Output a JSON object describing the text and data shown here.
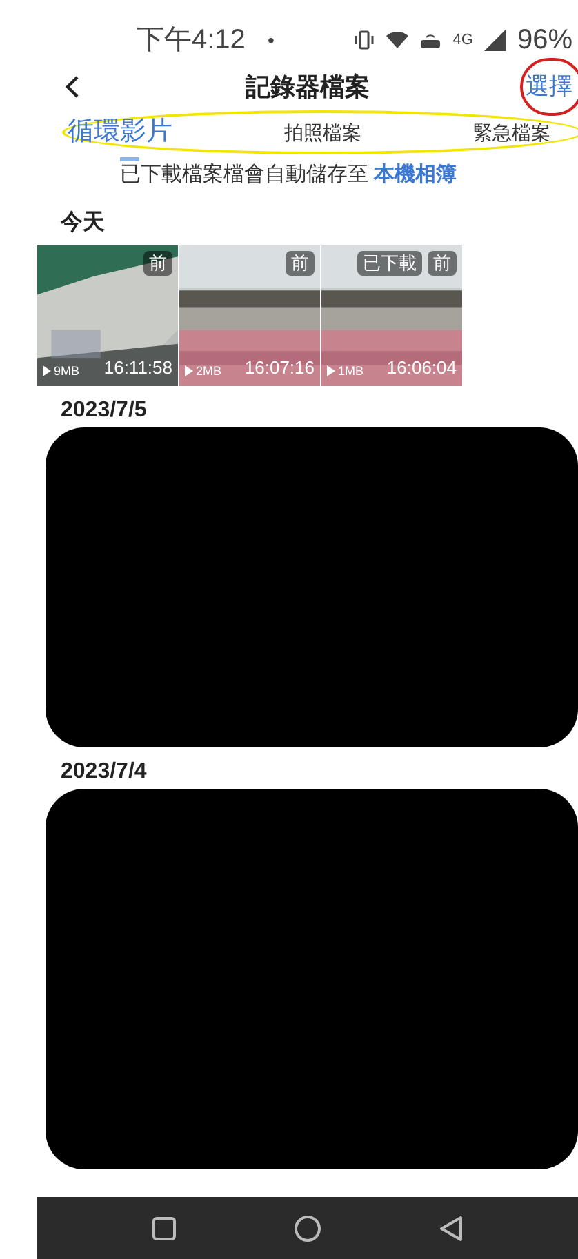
{
  "status_bar": {
    "time": "下午4:12",
    "dot": "•",
    "network": "4G",
    "battery": "96%"
  },
  "header": {
    "title": "記錄器檔案",
    "action": "選擇"
  },
  "tabs": [
    {
      "label": "循環影片",
      "selected": true
    },
    {
      "label": "拍照檔案",
      "selected": false
    },
    {
      "label": "緊急檔案",
      "selected": false
    }
  ],
  "notice": {
    "text": "已下載檔案檔會自動儲存至",
    "link": "本機相簿"
  },
  "sections": [
    {
      "date": "今天",
      "videos": [
        {
          "camera": "前",
          "size": "9MB",
          "time": "16:11:58"
        },
        {
          "camera": "前",
          "size": "2MB",
          "time": "16:07:16"
        },
        {
          "camera": "前",
          "size": "1MB",
          "time": "16:06:04",
          "status": "已下載"
        }
      ]
    },
    {
      "date": "2023/7/5",
      "kind": "redacted"
    },
    {
      "date": "2023/7/4",
      "kind": "redacted"
    }
  ]
}
